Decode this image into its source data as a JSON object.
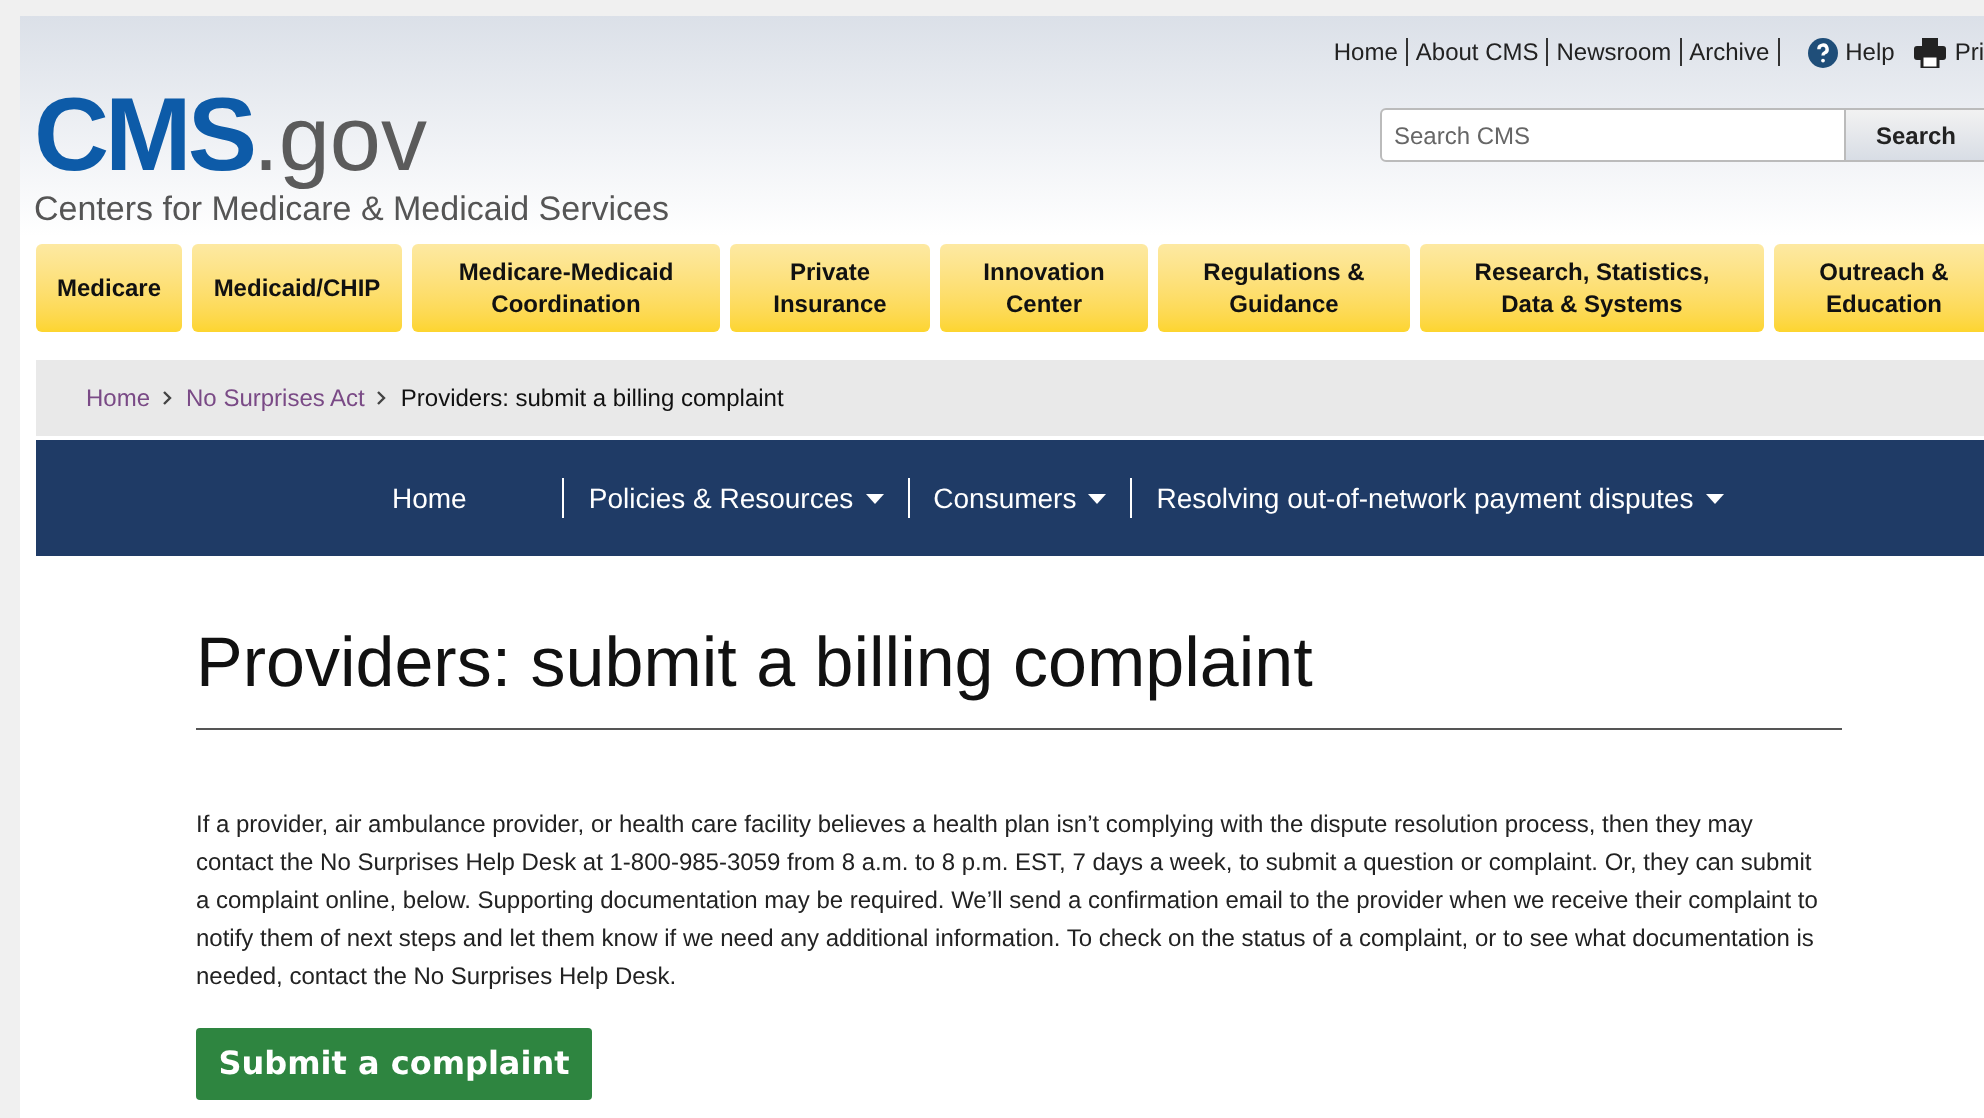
{
  "utility_links": [
    "Home",
    "About CMS",
    "Newsroom",
    "Archive"
  ],
  "help": "Help",
  "print": "Pri",
  "logo": {
    "primary": "CMS",
    "secondary": ".gov",
    "subtitle": "Centers for Medicare & Medicaid Services"
  },
  "search": {
    "placeholder": "Search CMS",
    "button": "Search"
  },
  "main_nav": [
    {
      "line1": "Medicare"
    },
    {
      "line1": "Medicaid/CHIP"
    },
    {
      "line1": "Medicare-Medicaid",
      "line2": "Coordination"
    },
    {
      "line1": "Private",
      "line2": "Insurance"
    },
    {
      "line1": "Innovation",
      "line2": "Center"
    },
    {
      "line1": "Regulations &",
      "line2": "Guidance"
    },
    {
      "line1": "Research, Statistics,",
      "line2": "Data & Systems"
    },
    {
      "line1": "Outreach &",
      "line2": "Education"
    }
  ],
  "breadcrumb": [
    {
      "label": "Home",
      "kind": "link"
    },
    {
      "label": "No Surprises Act",
      "kind": "link"
    },
    {
      "label": "Providers: submit a billing complaint",
      "kind": "current"
    }
  ],
  "section_nav": [
    {
      "label": "Home",
      "dropdown": false
    },
    {
      "label": "Policies & Resources",
      "dropdown": true
    },
    {
      "label": "Consumers",
      "dropdown": true
    },
    {
      "label": "Resolving out-of-network payment disputes",
      "dropdown": true
    }
  ],
  "title": "Providers: submit a billing complaint",
  "body": "If a provider, air ambulance provider, or health care facility believes a health plan isn’t complying with the dispute resolution process, then they may contact the No Surprises Help Desk at 1-800-985-3059 from 8 a.m. to 8 p.m. EST, 7 days a week, to submit a question or complaint. Or, they can submit a complaint online, below. Supporting documentation may be required. We’ll send a confirmation email to the provider when we receive their complaint to notify them of next steps and let them know if we need any additional information. To check on the status of a complaint, or to see what documentation is needed, contact the No Surprises Help Desk.",
  "submit_button": "Submit a complaint"
}
